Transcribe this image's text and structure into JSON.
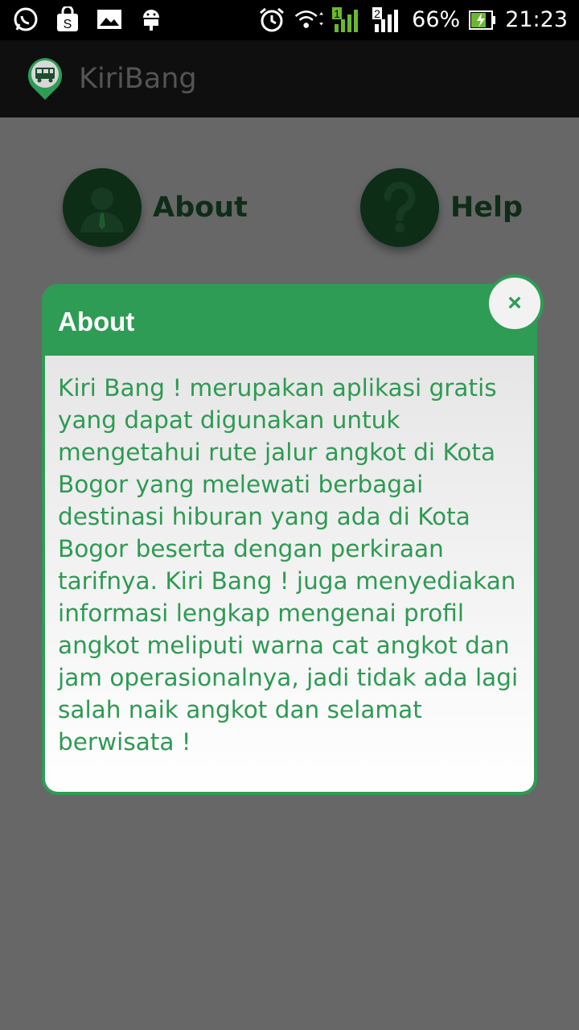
{
  "status_bar": {
    "battery": "66%",
    "time": "21:23",
    "sim1": "1",
    "sim2": "2",
    "icons_left": [
      "whatsapp-icon",
      "shopping-bag-icon",
      "gallery-icon",
      "android-icon"
    ],
    "icons_right": [
      "alarm-icon",
      "wifi-icon",
      "signal-icon",
      "battery-charging-icon"
    ]
  },
  "app_bar": {
    "title": "KiriBang"
  },
  "menu": {
    "about_label": "About",
    "help_label": "Help"
  },
  "dialog": {
    "title": "About",
    "close_label": "×",
    "body": "Kiri Bang ! merupakan aplikasi gratis yang dapat digunakan untuk mengetahui rute jalur angkot di Kota Bogor yang melewati berbagai destinasi hiburan yang ada di Kota Bogor beserta dengan perkiraan tarifnya. Kiri Bang ! juga menyediakan informasi lengkap mengenai profil angkot meliputi warna cat angkot dan jam operasionalnya, jadi tidak ada lagi salah naik angkot dan selamat berwisata !"
  },
  "colors": {
    "accent": "#2e9c55",
    "overlay": "#676767",
    "appbar": "#0f0f0f"
  }
}
